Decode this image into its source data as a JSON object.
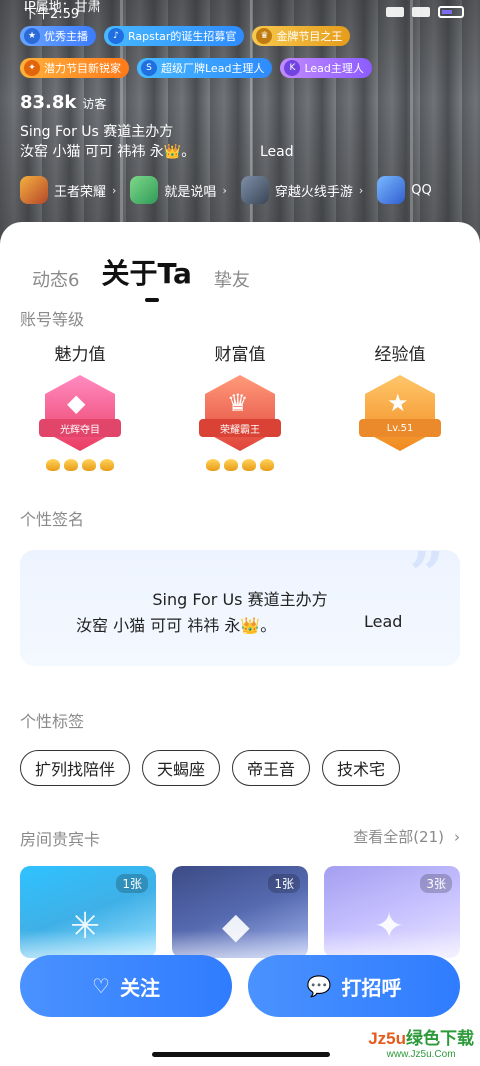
{
  "status": {
    "time": "下午2:59",
    "ip": "IP属地：甘肃"
  },
  "badges_row1": [
    {
      "label": "优秀主播",
      "icon": "anchor-icon"
    },
    {
      "label": "Rapstar的诞生招募官",
      "icon": "mic-icon"
    },
    {
      "label": "金牌节目之王",
      "icon": "trophy-icon"
    }
  ],
  "badges_row2": [
    {
      "label": "潜力节目新锐家",
      "icon": "star-icon"
    },
    {
      "label": "超级厂牌Lead主理人",
      "icon": "s-icon"
    },
    {
      "label": "Lead主理人",
      "icon": "kh-icon"
    }
  ],
  "visitors": {
    "count": "83.8k",
    "label": "访客"
  },
  "signature_top": {
    "line1": "Sing For Us 赛道主办方",
    "line2": "汝窑 小猫 可可 祎祎 永👑。",
    "lead": "Lead"
  },
  "games": [
    {
      "label": "王者荣耀"
    },
    {
      "label": "就是说唱"
    },
    {
      "label": "穿越火线手游"
    },
    {
      "label": "QQ"
    }
  ],
  "tabs": [
    {
      "label": "动态6"
    },
    {
      "label": "关于Ta"
    },
    {
      "label": "挚友"
    }
  ],
  "sections": {
    "account_level": "账号等级",
    "signature": "个性签名",
    "tags": "个性标签",
    "vip_cards": "房间贵宾卡",
    "view_all": "查看全部(21)"
  },
  "levels": [
    {
      "title": "魅力值",
      "ribbon": "光辉夺目"
    },
    {
      "title": "财富值",
      "ribbon": "荣耀霸王"
    },
    {
      "title": "经验值",
      "ribbon": "Lv.51"
    }
  ],
  "signature_card": {
    "line1": "Sing For Us 赛道主办方",
    "line2": "汝窑 小猫 可可 祎祎 永👑。",
    "lead": "Lead"
  },
  "tags": [
    "扩列找陪伴",
    "天蝎座",
    "帝王音",
    "技术宅"
  ],
  "vip_cards": [
    {
      "count": "1张"
    },
    {
      "count": "1张"
    },
    {
      "count": "3张"
    }
  ],
  "buttons": {
    "follow": "关注",
    "greet": "打招呼"
  },
  "watermark": {
    "title_a": "Jz5u",
    "title_b": "绿色下载",
    "url": "www.Jz5u.Com"
  },
  "colors": {
    "accent": "#2f7cff",
    "tag_border": "#333333",
    "muted": "#8a8a8a"
  }
}
